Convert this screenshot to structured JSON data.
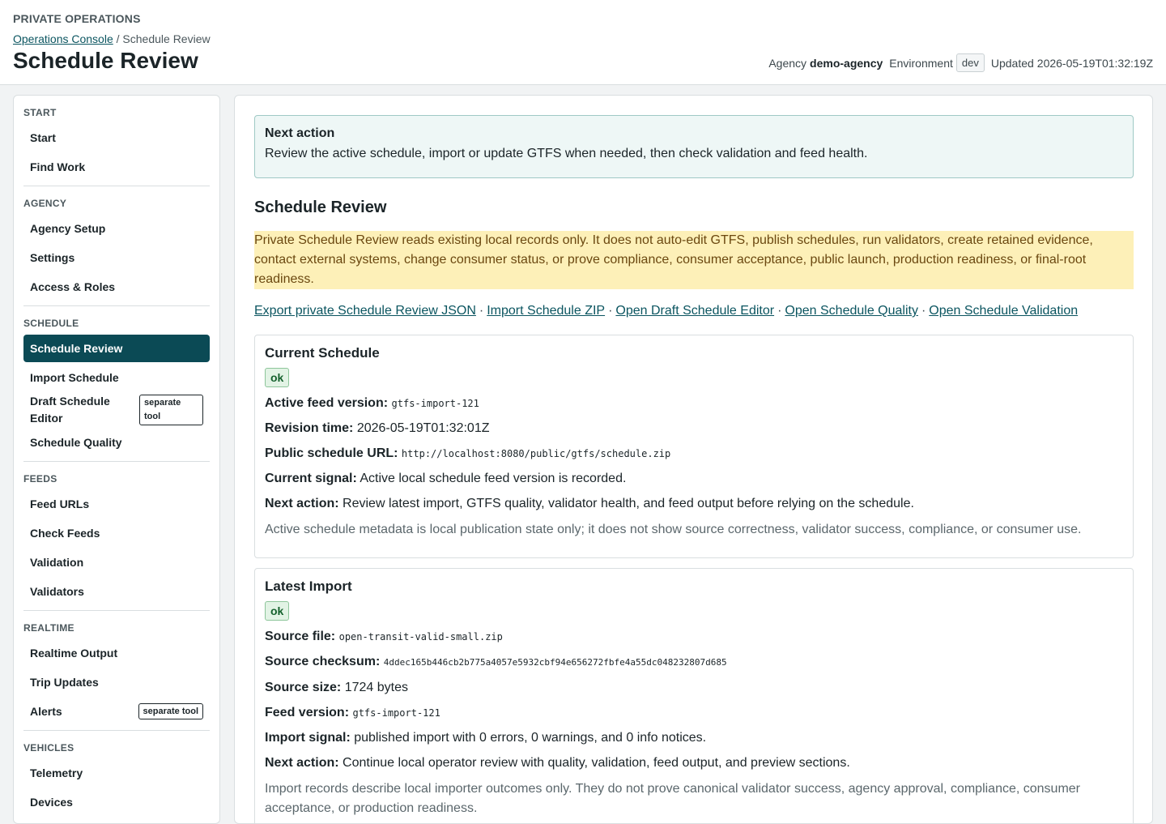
{
  "header": {
    "eyebrow": "PRIVATE OPERATIONS",
    "breadcrumb_link": "Operations Console",
    "breadcrumb_sep": " / ",
    "breadcrumb_current": "Schedule Review",
    "title": "Schedule Review",
    "agency_label": "Agency",
    "agency_value": "demo-agency",
    "environment_label": "Environment",
    "environment_value": "dev",
    "updated_label": "Updated",
    "updated_value": "2026-05-19T01:32:19Z"
  },
  "sidebar": {
    "groups": [
      {
        "label": "START",
        "items": [
          {
            "label": "Start"
          },
          {
            "label": "Find Work"
          }
        ]
      },
      {
        "label": "AGENCY",
        "items": [
          {
            "label": "Agency Setup"
          },
          {
            "label": "Settings"
          },
          {
            "label": "Access & Roles"
          }
        ]
      },
      {
        "label": "SCHEDULE",
        "items": [
          {
            "label": "Schedule Review",
            "active": true
          },
          {
            "label": "Import Schedule"
          },
          {
            "label": "Draft Schedule Editor",
            "badge": "separate tool"
          },
          {
            "label": "Schedule Quality"
          }
        ]
      },
      {
        "label": "FEEDS",
        "items": [
          {
            "label": "Feed URLs"
          },
          {
            "label": "Check Feeds"
          },
          {
            "label": "Validation"
          },
          {
            "label": "Validators"
          }
        ]
      },
      {
        "label": "REALTIME",
        "items": [
          {
            "label": "Realtime Output"
          },
          {
            "label": "Trip Updates"
          },
          {
            "label": "Alerts",
            "badge": "separate tool"
          }
        ]
      },
      {
        "label": "VEHICLES",
        "items": [
          {
            "label": "Telemetry"
          },
          {
            "label": "Devices"
          }
        ]
      }
    ]
  },
  "main": {
    "next_action": {
      "title": "Next action",
      "body": "Review the active schedule, import or update GTFS when needed, then check validation and feed health."
    },
    "section_title": "Schedule Review",
    "warning": "Private Schedule Review reads existing local records only. It does not auto-edit GTFS, publish schedules, run validators, create retained evidence, contact external systems, change consumer status, or prove compliance, consumer acceptance, public launch, production readiness, or final-root readiness.",
    "links": {
      "export_json": "Export private Schedule Review JSON",
      "import_zip": "Import Schedule ZIP",
      "draft_editor": "Open Draft Schedule Editor",
      "quality": "Open Schedule Quality",
      "validation": "Open Schedule Validation",
      "separator": "·"
    },
    "current_schedule": {
      "title": "Current Schedule",
      "status": "ok",
      "active_feed_label": "Active feed version:",
      "active_feed_value": "gtfs-import-121",
      "revision_label": "Revision time:",
      "revision_value": "2026-05-19T01:32:01Z",
      "public_url_label": "Public schedule URL:",
      "public_url_value": "http://localhost:8080/public/gtfs/schedule.zip",
      "signal_label": "Current signal:",
      "signal_value": "Active local schedule feed version is recorded.",
      "next_label": "Next action:",
      "next_value": "Review latest import, GTFS quality, validator health, and feed output before relying on the schedule.",
      "note": "Active schedule metadata is local publication state only; it does not show source correctness, validator success, compliance, or consumer use."
    },
    "latest_import": {
      "title": "Latest Import",
      "status": "ok",
      "source_file_label": "Source file:",
      "source_file_value": "open-transit-valid-small.zip",
      "checksum_label": "Source checksum:",
      "checksum_value": "4ddec165b446cb2b775a4057e5932cbf94e656272fbfe4a55dc048232807d685",
      "size_label": "Source size:",
      "size_value": "1724 bytes",
      "feed_version_label": "Feed version:",
      "feed_version_value": "gtfs-import-121",
      "signal_label": "Import signal:",
      "signal_value": "published import with 0 errors, 0 warnings, and 0 info notices.",
      "next_label": "Next action:",
      "next_value": "Continue local operator review with quality, validation, feed output, and preview sections.",
      "note": "Import records describe local importer outcomes only. They do not prove canonical validator success, agency approval, compliance, consumer acceptance, or production readiness."
    }
  }
}
